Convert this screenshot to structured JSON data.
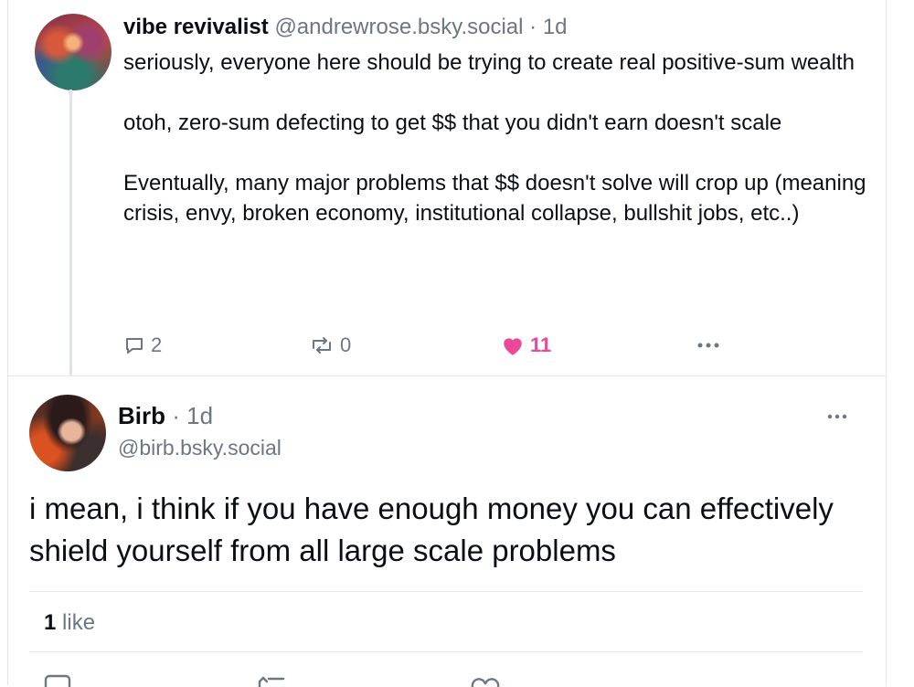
{
  "parent_post": {
    "display_name": "vibe revivalist",
    "handle": "@andrewrose.bsky.social",
    "separator": "·",
    "time": "1d",
    "paragraphs": [
      "seriously, everyone here should be trying to create real positive-sum wealth",
      "otoh, zero-sum defecting to get $$ that you didn't earn doesn't scale",
      "Eventually, many major problems that $$ doesn't solve will crop up (meaning crisis, envy, broken economy, institutional collapse, bullshit jobs, etc..)"
    ],
    "reply_count": "2",
    "repost_count": "0",
    "like_count": "11",
    "like_color": "#ec4899"
  },
  "focused_post": {
    "display_name": "Birb",
    "separator": "·",
    "time": "1d",
    "handle": "@birb.bsky.social",
    "text": "i mean, i think if you have enough money you can effectively shield yourself from all large scale problems",
    "like_count": "1",
    "like_label": "like"
  },
  "icons": [
    "reply-icon",
    "repost-icon",
    "heart-icon",
    "more-icon"
  ]
}
